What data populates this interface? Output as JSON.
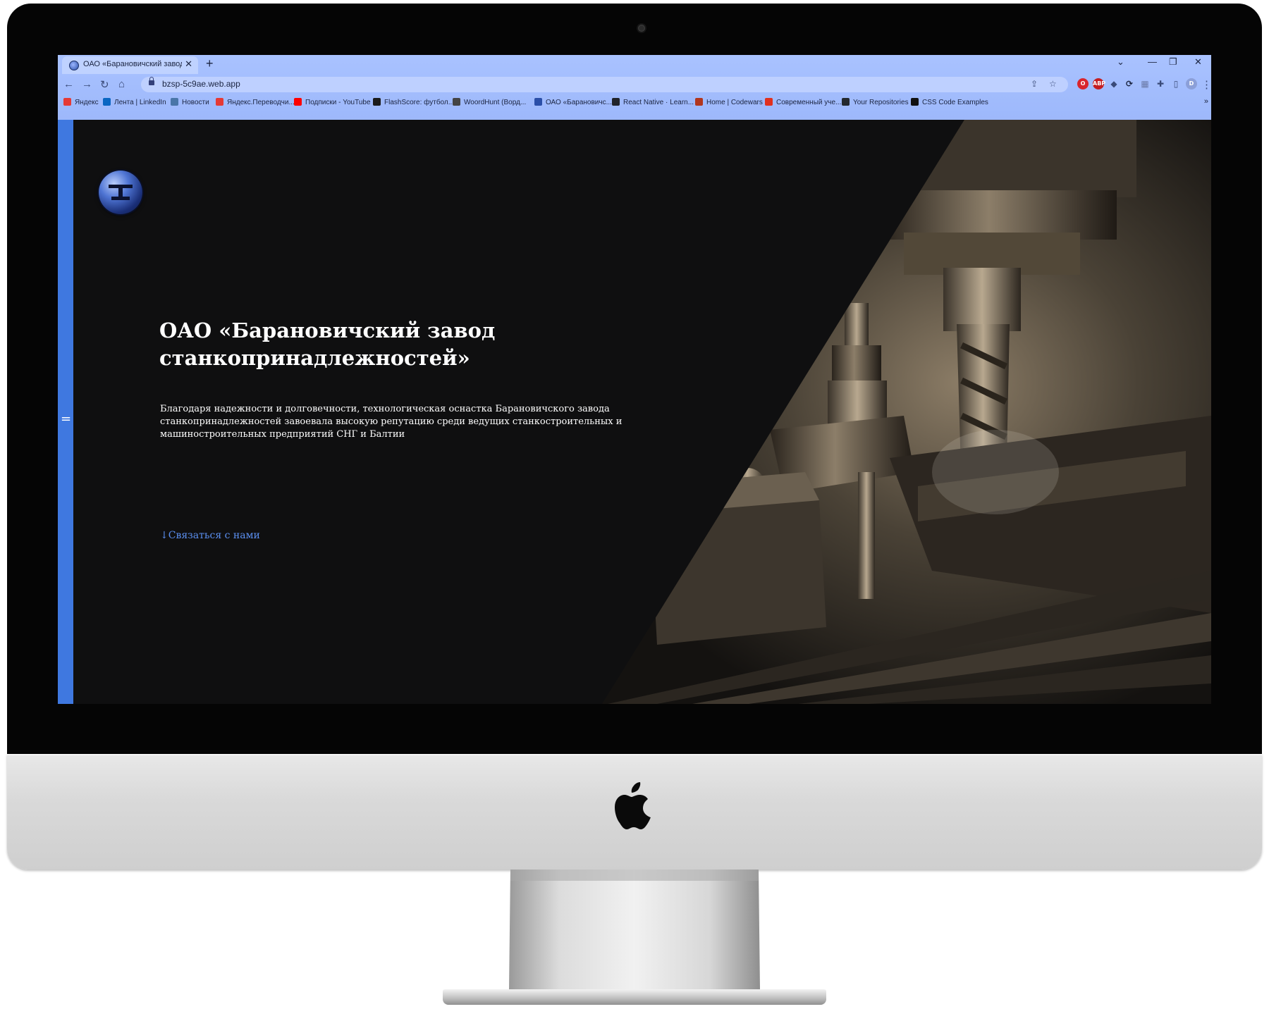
{
  "browser": {
    "tab_title": "ОАО «Барановичский завод ст",
    "tab_close": "✕",
    "new_tab": "+",
    "window_controls": {
      "menu": "⌄",
      "minimize": "—",
      "restore": "❐",
      "close": "✕"
    },
    "nav": {
      "back": "←",
      "forward": "→",
      "reload": "↻",
      "home": "⌂"
    },
    "url": "bzsp-5c9ae.web.app",
    "omnibox_icons": {
      "share": "⇪",
      "star": "☆"
    },
    "extensions": [
      {
        "name": "opera-ext",
        "label": "O",
        "color": "#d9262d"
      },
      {
        "name": "adblock-ext",
        "label": "ABP",
        "color": "#c41d21"
      },
      {
        "name": "shield-ext",
        "label": "◆",
        "color": "#3a4a78"
      },
      {
        "name": "sync-ext",
        "label": "⟳",
        "color": "#1b2440"
      },
      {
        "name": "grid-ext",
        "label": "▦",
        "color": "#6b7aa8"
      },
      {
        "name": "puzzle-ext",
        "label": "✚",
        "color": "#3a4a78"
      },
      {
        "name": "sidepanel-ext",
        "label": "▯",
        "color": "#3a4a78"
      },
      {
        "name": "profile-avatar",
        "label": "D",
        "color": "#8b9fd8"
      }
    ],
    "menu_dots": "⋮",
    "bookmarks": [
      {
        "label": "Яндекс",
        "color": "#e53935"
      },
      {
        "label": "Лента | LinkedIn",
        "color": "#0a66c2"
      },
      {
        "label": "Новости",
        "color": "#4a76a8"
      },
      {
        "label": "Яндекс.Переводчи...",
        "color": "#e53935"
      },
      {
        "label": "Подписки - YouTube",
        "color": "#ff0000"
      },
      {
        "label": "FlashScore: футбол...",
        "color": "#1b1b1b"
      },
      {
        "label": "WoordHunt (Ворд...",
        "color": "#444444"
      },
      {
        "label": "ОАО «Барановичс...",
        "color": "#2b4fa8"
      },
      {
        "label": "React Native · Learn...",
        "color": "#20232a"
      },
      {
        "label": "Home | Codewars",
        "color": "#b1361e"
      },
      {
        "label": "Современный уче...",
        "color": "#e0301e"
      },
      {
        "label": "Your Repositories",
        "color": "#24292e"
      },
      {
        "label": "CSS Code Examples",
        "color": "#111111"
      }
    ],
    "bookmarks_more": "»"
  },
  "hero": {
    "title": "ОАО «Барановичский завод станкопринадлежностей»",
    "description": "Благодаря надежности и долговечности, технологическая оснастка Барановичского завода станкопринадлежностей завоевала высокую репутацию среди ведущих станкостроительных и машиностроительных предприятий СНГ и Балтии",
    "cta": "↓Связаться с нами"
  },
  "sidebar": {
    "handle": "="
  },
  "colors": {
    "page_background": "#0f0f10",
    "side_rail": "#3f78e0",
    "link": "#5b8ff0",
    "chrome": "#a9c2ff"
  }
}
